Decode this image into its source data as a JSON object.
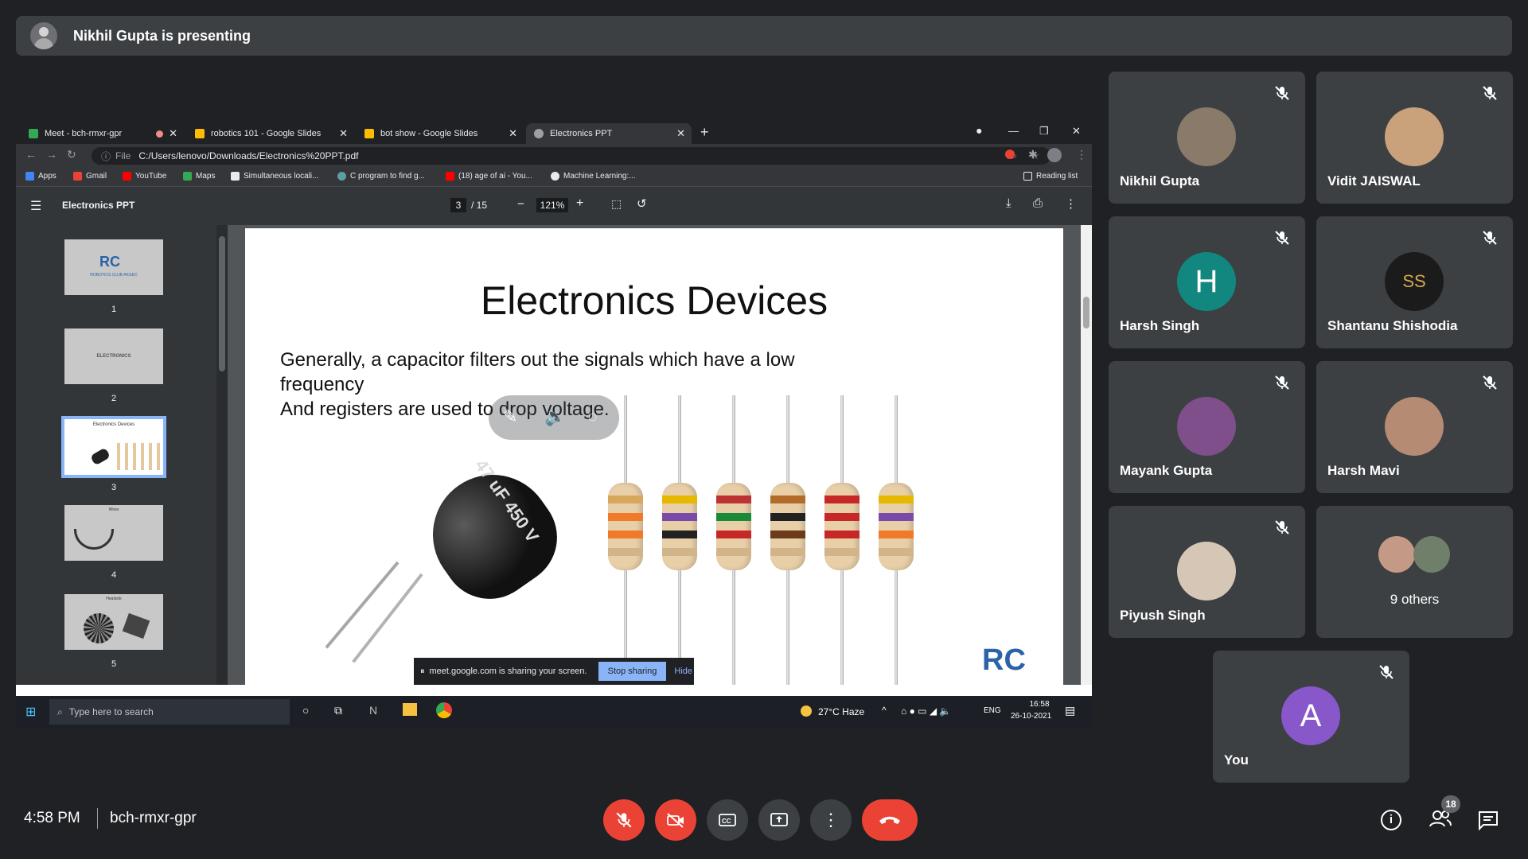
{
  "banner": {
    "text": "Nikhil Gupta is presenting"
  },
  "browser": {
    "tabs": [
      {
        "label": "Meet - bch-rmxr-gpr"
      },
      {
        "label": "robotics 101 - Google Slides"
      },
      {
        "label": "bot show - Google Slides"
      },
      {
        "label": "Electronics PPT"
      }
    ],
    "address": "C:/Users/lenovo/Downloads/Electronics%20PPT.pdf",
    "file_label": "File",
    "bookmarks": [
      "Apps",
      "Gmail",
      "YouTube",
      "Maps",
      "Simultaneous locali...",
      "C program to find g...",
      "(18) age of ai - You...",
      "Machine Learning:..."
    ],
    "reading_list": "Reading list"
  },
  "pdf": {
    "title": "Electronics PPT",
    "page_current": "3",
    "page_total": "/ 15",
    "zoom": "121%",
    "thumbs": [
      {
        "num": "1",
        "caption": "ROBOTICS CLUB AKGEC"
      },
      {
        "num": "2",
        "caption": "ELECTRONICS"
      },
      {
        "num": "3",
        "caption": "Electronics Devices"
      },
      {
        "num": "4",
        "caption": "Wires"
      },
      {
        "num": "5",
        "caption": "Heatsink"
      }
    ],
    "slide": {
      "title": "Electronics Devices",
      "line1": "Generally, a capacitor filters out the signals which have a low",
      "line2": "frequency",
      "line3": "And registers are used to drop voltage.",
      "capacitor_label": "47 uF 450 V",
      "logo": "RC"
    },
    "share_notice": {
      "text": "meet.google.com is sharing your screen.",
      "stop": "Stop sharing",
      "hide": "Hide"
    }
  },
  "taskbar": {
    "search": "Type here to search",
    "weather": "27°C  Haze",
    "lang": "ENG",
    "time": "16:58",
    "date": "26-10-2021"
  },
  "participants": [
    {
      "name": "Nikhil Gupta",
      "initial": "",
      "color": "#8a7a6a"
    },
    {
      "name": "Vidit JAISWAL",
      "initial": "",
      "color": "#c9a27b"
    },
    {
      "name": "Harsh Singh",
      "initial": "H",
      "color": "#12877f"
    },
    {
      "name": "Shantanu Shishodia",
      "initial": "SS",
      "color": "#1b1b1b"
    },
    {
      "name": "Mayank Gupta",
      "initial": "",
      "color": "#7e4f8a"
    },
    {
      "name": "Harsh Mavi",
      "initial": "",
      "color": "#b58b73"
    },
    {
      "name": "Piyush Singh",
      "initial": "",
      "color": "#d6c6b6"
    },
    {
      "name": "9 others",
      "initial": "",
      "color": "#9a7f70"
    },
    {
      "name": "You",
      "initial": "A",
      "color": "#8857c9"
    }
  ],
  "footer": {
    "time": "4:58 PM",
    "meeting_code": "bch-rmxr-gpr",
    "people_count": "18"
  },
  "colors": {
    "accent_red": "#ea4335",
    "accent_blue": "#8ab4f8",
    "tile_bg": "#3c4043"
  }
}
